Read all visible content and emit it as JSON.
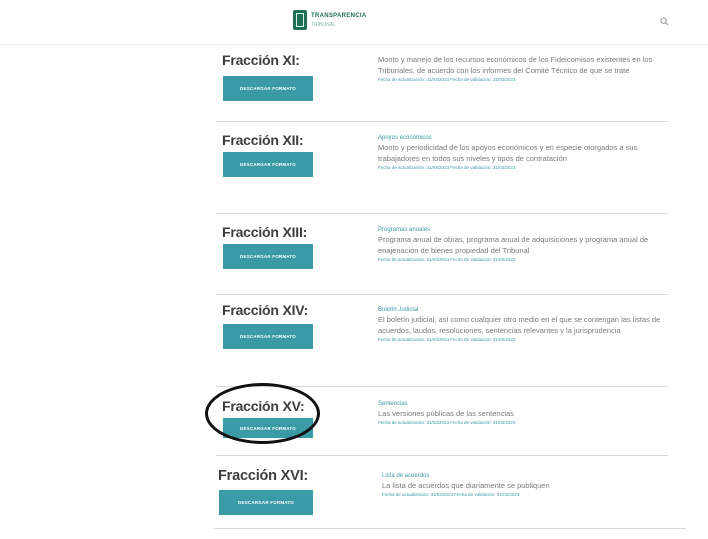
{
  "header": {
    "logo_name": "TRANSPARENCIA",
    "logo_sub": "TRIBUNAL"
  },
  "download_label": "DESCARGAR FORMATO",
  "sections": [
    {
      "title": "Fracción XI:",
      "category": "",
      "description": "Monto y manejo de los recursos económicos de los Fideicomisos existentes en los Tribunales, de acuerdo con los informes del Comité Técnico de que se trate",
      "meta": "Fecha de actualización: 31/03/2023  Fecha de validación: 31/03/2023"
    },
    {
      "title": "Fracción XII:",
      "category": "Apoyos económicos",
      "description": "Monto y periodicidad de los apoyos económicos y en especie otorgados a sus trabajadores en todos sus niveles y tipos de contratación",
      "meta": "Fecha de actualización: 31/03/2023  Fecha de validación: 31/03/2023"
    },
    {
      "title": "Fracción XIII:",
      "category": "Programas anuales",
      "description": "Programa anual de obras, programa anual de adquisiciones y programa anual de enajenación de bienes propiedad del Tribunal",
      "meta": "Fecha de actualización: 31/03/2023  Fecha de validación: 31/03/2023"
    },
    {
      "title": "Fracción XIV:",
      "category": "Boletín Judicial",
      "description": "El boletín judicial, así como cualquier otro medio en el que se contengan las listas de acuerdos, laudos, resoluciones, sentencias relevantes y la jurisprudencia",
      "meta": "Fecha de actualización: 31/03/2023  Fecha de validación: 31/03/2023"
    },
    {
      "title": "Fracción XV:",
      "category": "Sentencias",
      "description": "Las versiones públicas de las sentencias",
      "meta": "Fecha de actualización: 31/03/2023  Fecha de validación: 31/03/2023"
    },
    {
      "title": "Fracción XVI:",
      "category": "Lista de acuerdos",
      "description": "La lista de acuerdos que diariamente se publiquen",
      "meta": "Fecha de actualización: 31/03/2023  Fecha de validación: 31/03/2023"
    }
  ]
}
